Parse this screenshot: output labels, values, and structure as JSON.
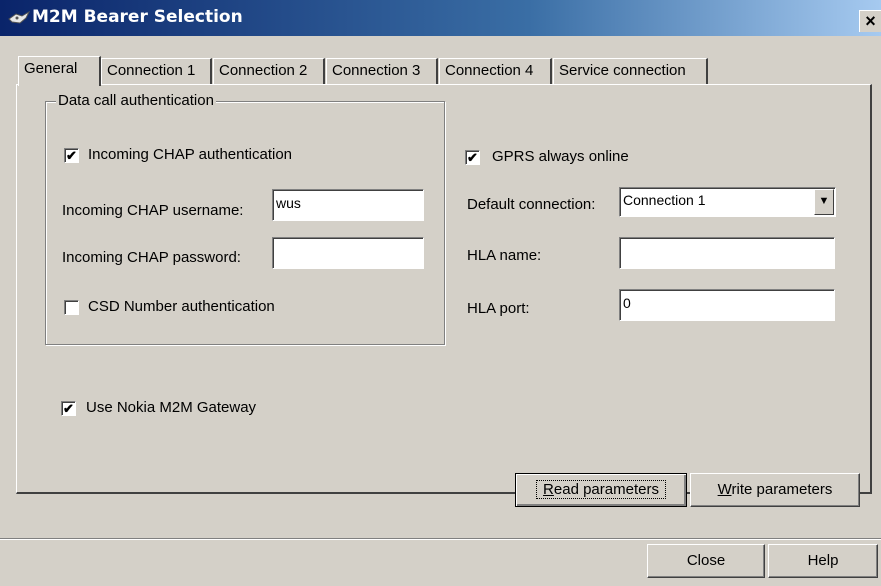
{
  "window": {
    "title": "M2M Bearer Selection",
    "close_glyph": "×"
  },
  "tabs": [
    {
      "label": "General",
      "active": true
    },
    {
      "label": "Connection 1"
    },
    {
      "label": "Connection 2"
    },
    {
      "label": "Connection 3"
    },
    {
      "label": "Connection 4"
    },
    {
      "label": "Service connection"
    }
  ],
  "auth_group": {
    "legend": "Data call authentication",
    "incoming_chap": {
      "label": "Incoming CHAP authentication",
      "checked": true
    },
    "username": {
      "label": "Incoming CHAP username:",
      "value": "wus"
    },
    "password": {
      "label": "Incoming CHAP password:",
      "value": ""
    },
    "csd_number": {
      "label": "CSD Number authentication",
      "checked": false
    }
  },
  "gprs": {
    "label": "GPRS always online",
    "checked": true
  },
  "default_connection": {
    "label": "Default connection:",
    "value": "Connection 1"
  },
  "hla_name": {
    "label": "HLA name:",
    "value": ""
  },
  "hla_port": {
    "label": "HLA port:",
    "value": "0"
  },
  "gateway": {
    "label": "Use Nokia M2M Gateway",
    "checked": true
  },
  "buttons": {
    "read_first": "R",
    "read_rest": "ead parameters",
    "write_first": "W",
    "write_rest": "rite parameters",
    "close": "Close",
    "help": "Help"
  },
  "check_glyph": "✔",
  "dropdown_glyph": "▼"
}
